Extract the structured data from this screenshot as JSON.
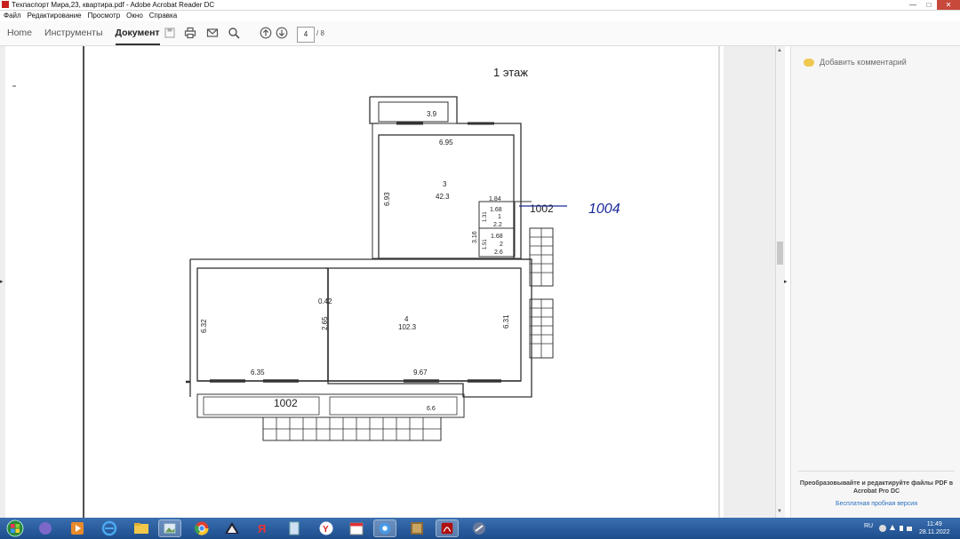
{
  "window": {
    "title": "Техпаспорт Мира,23, квартира.pdf - Adobe Acrobat Reader DC",
    "controls": [
      "—",
      "□",
      "✕"
    ]
  },
  "menu": [
    "Файл",
    "Редактирование",
    "Просмотр",
    "Окно",
    "Справка"
  ],
  "tabs": [
    {
      "label": "Home",
      "active": false
    },
    {
      "label": "Инструменты",
      "active": false
    },
    {
      "label": "Документ",
      "active": true
    }
  ],
  "toolbar_icons": [
    "save-icon",
    "print-icon",
    "email-icon",
    "search-icon",
    "page-up-icon",
    "page-down-icon"
  ],
  "page_nav": {
    "current": "4",
    "total": "/ 8"
  },
  "plan": {
    "floor_title": "1 этаж",
    "dims": {
      "top_small": "3.9",
      "room3_width": "6.95",
      "room3_height": "6.93",
      "room3_id": "3",
      "room3_area": "42.3",
      "w184": "1.84",
      "w168a": "1.68",
      "room1_h": "1.31",
      "room1_id": "1",
      "room1_area": "2.2",
      "w168b": "1.68",
      "room2_h": "1.51",
      "room2_id": "2",
      "room2_area": "2.6",
      "h316": "3.16",
      "corner": "0.42",
      "left_h": "6.32",
      "inner_h": "2.65",
      "right_h": "6.31",
      "room4_id": "4",
      "room4_area": "102.3",
      "bottom_left_w": "6.35",
      "bottom_right_w": "9.67",
      "porch_w": "6.6"
    },
    "building_number": "1002",
    "label_right": "1002",
    "handwritten": "1004"
  },
  "right_panel": {
    "comment_label": "Добавить комментарий",
    "promo_text": "Преобразовывайте и редактируйте файлы PDF в Acrobat Pro DC",
    "trial_link": "Бесплатная пробная версия"
  },
  "taskbar": {
    "lang": "RU",
    "time": "11:49",
    "date": "28.11.2022"
  },
  "colors": {
    "accent": "#1d4d8c",
    "close": "#c7493b",
    "ink": "#1a2a99"
  }
}
